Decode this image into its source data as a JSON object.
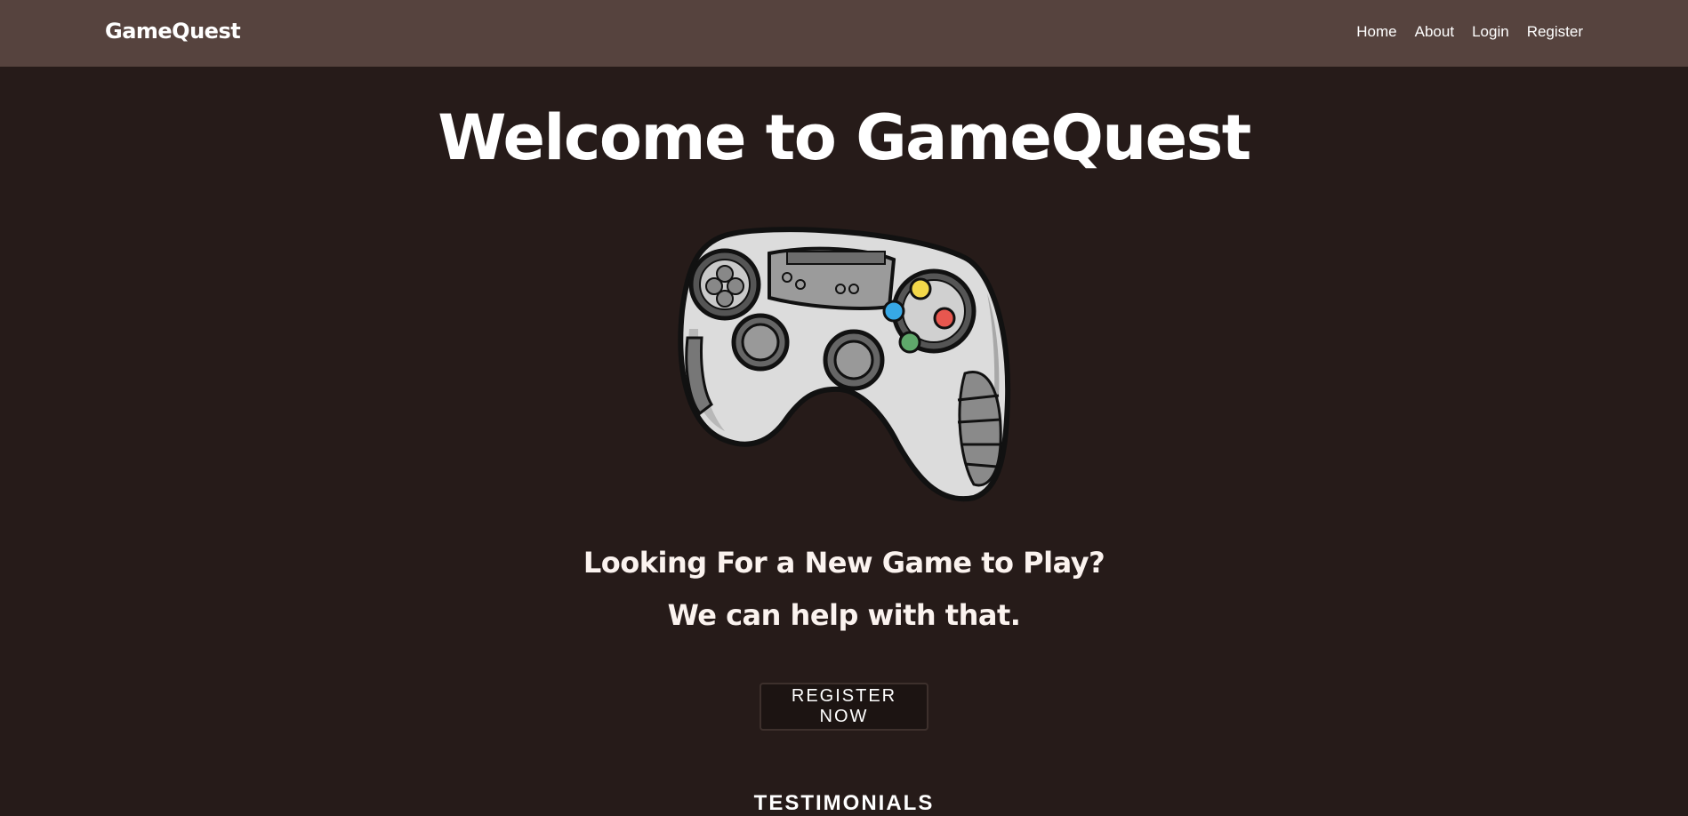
{
  "navbar": {
    "brand": "GameQuest",
    "links": [
      {
        "label": "Home"
      },
      {
        "label": "About"
      },
      {
        "label": "Login"
      },
      {
        "label": "Register"
      }
    ]
  },
  "hero": {
    "title": "Welcome to GameQuest",
    "image_icon": "game-controller-illustration",
    "tagline_line1": "Looking For a New Game to Play?",
    "tagline_line2": "We can help with that.",
    "cta_label": "REGISTER NOW"
  },
  "testimonials": {
    "heading": "TESTIMONIALS"
  },
  "colors": {
    "background": "#261b19",
    "navbar": "#56433e",
    "button_bg": "#1c1412",
    "button_yellow": "#f3d84a",
    "button_red": "#e8574f",
    "button_blue": "#37a8e6",
    "button_green": "#5fa86b"
  }
}
